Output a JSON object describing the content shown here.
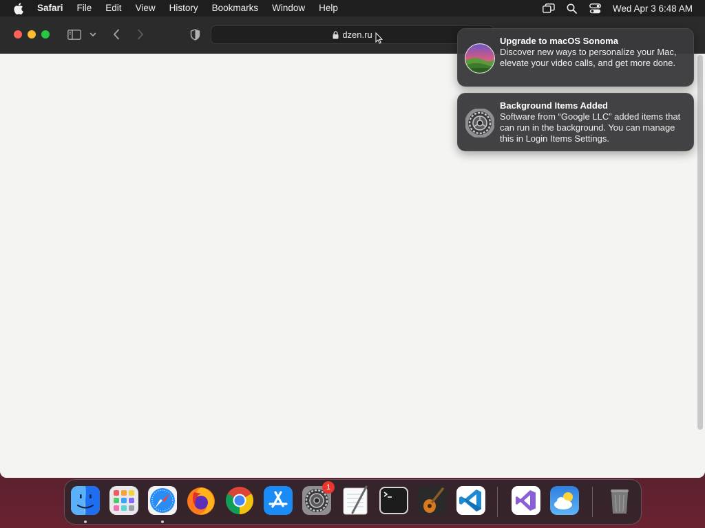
{
  "menubar": {
    "app_name": "Safari",
    "items": [
      "File",
      "Edit",
      "View",
      "History",
      "Bookmarks",
      "Window",
      "Help"
    ],
    "clock": "Wed Apr 3  6:48 AM",
    "status_icons": [
      "screen-mirroring-icon",
      "spotlight-search-icon",
      "control-center-icon"
    ]
  },
  "browser": {
    "address": "dzen.ru",
    "toolbar_icons": [
      "sidebar-toggle-icon",
      "chevron-down-icon",
      "back-icon",
      "forward-icon",
      "privacy-shield-icon",
      "lock-icon"
    ]
  },
  "notifications": [
    {
      "title": "Upgrade to macOS Sonoma",
      "body": "Discover new ways to personalize your Mac, elevate your video calls, and get more done.",
      "icon": "macos-sonoma-icon"
    },
    {
      "title": "Background Items Added",
      "body": "Software from “Google LLC” added items that can run in the background. You can manage this in Login Items Settings.",
      "icon": "system-settings-gear-icon"
    }
  ],
  "dock": {
    "apps": [
      {
        "name": "Finder",
        "icon": "finder-icon",
        "running": true
      },
      {
        "name": "Launchpad",
        "icon": "launchpad-icon",
        "running": false
      },
      {
        "name": "Safari",
        "icon": "safari-icon",
        "running": true
      },
      {
        "name": "Firefox",
        "icon": "firefox-icon",
        "running": false
      },
      {
        "name": "Google Chrome",
        "icon": "chrome-icon",
        "running": false
      },
      {
        "name": "App Store",
        "icon": "app-store-icon",
        "running": false
      },
      {
        "name": "System Settings",
        "icon": "system-settings-icon",
        "running": false,
        "badge": "1"
      },
      {
        "name": "TextEdit",
        "icon": "textedit-icon",
        "running": false
      },
      {
        "name": "Terminal",
        "icon": "terminal-icon",
        "running": false
      },
      {
        "name": "GarageBand",
        "icon": "garageband-icon",
        "running": false
      },
      {
        "name": "Visual Studio Code",
        "icon": "vscode-icon",
        "running": false
      },
      {
        "name": "Visual Studio",
        "icon": "visual-studio-icon",
        "running": false
      },
      {
        "name": "Weather",
        "icon": "weather-icon",
        "running": false
      },
      {
        "name": "Trash",
        "icon": "trash-icon",
        "running": false
      }
    ]
  },
  "colors": {
    "close": "#fe5f57",
    "minimize": "#febc2e",
    "maximize": "#28c840",
    "badge": "#e9372f"
  }
}
